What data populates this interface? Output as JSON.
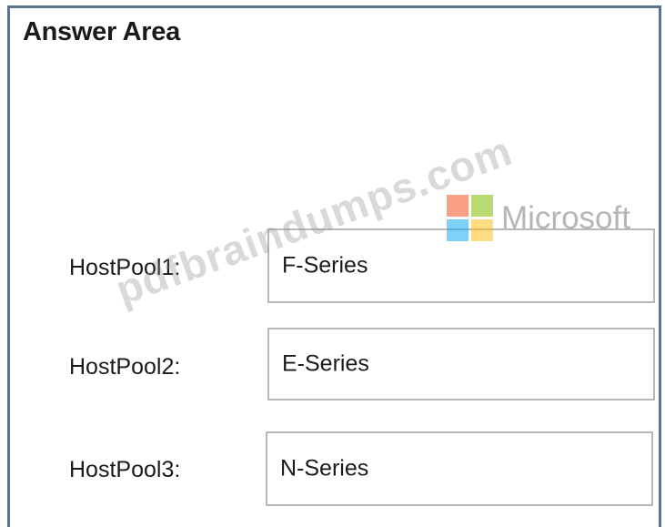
{
  "answer_area": {
    "title": "Answer Area"
  },
  "rows": [
    {
      "label": "HostPool1:",
      "value": "F-Series"
    },
    {
      "label": "HostPool2:",
      "value": "E-Series"
    },
    {
      "label": "HostPool3:",
      "value": "N-Series"
    }
  ],
  "watermark": {
    "text": "pdfbraindumps.com",
    "brand": "Microsoft"
  },
  "colors": {
    "frame_border": "#5e7488",
    "box_border": "#b8b8b8",
    "ms_red": "#f25022",
    "ms_green": "#7fba00",
    "ms_blue": "#00a4ef",
    "ms_yellow": "#ffb900"
  }
}
